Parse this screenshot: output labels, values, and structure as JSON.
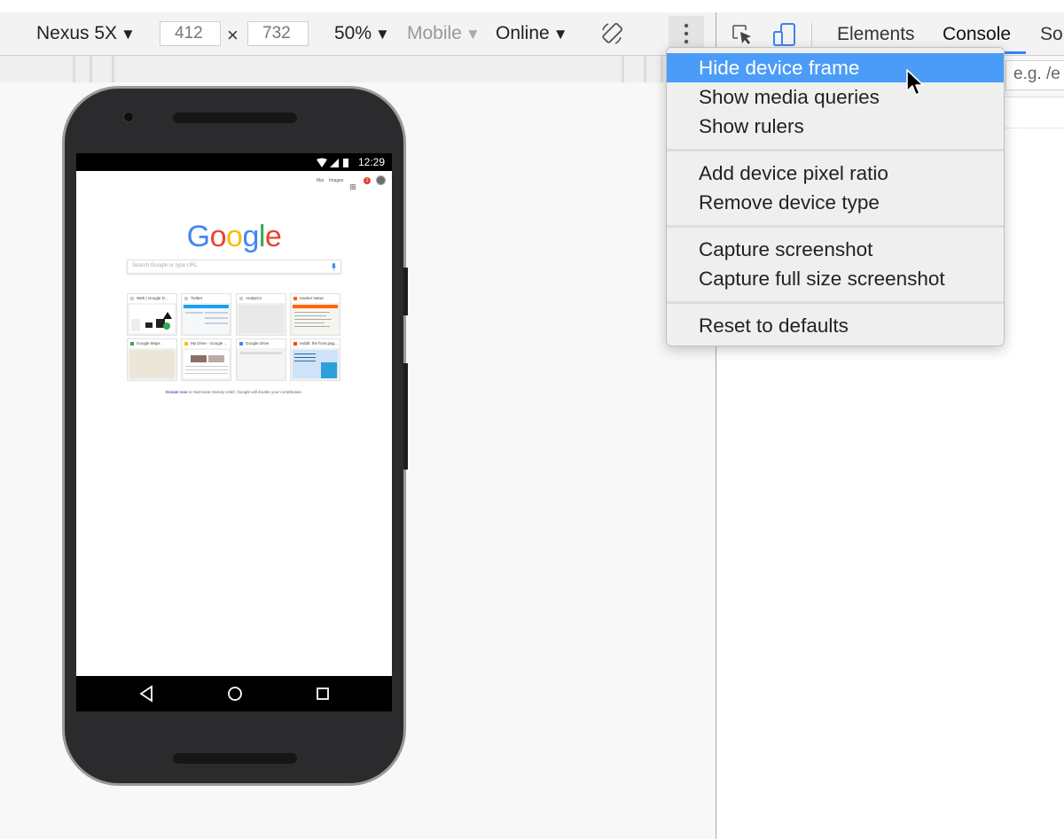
{
  "toolbar": {
    "device": "Nexus 5X",
    "width": "412",
    "height": "732",
    "dim_separator": "×",
    "zoom": "50%",
    "mode": "Mobile",
    "network": "Online",
    "caret": "▼"
  },
  "devtools": {
    "tabs": [
      "Elements",
      "Console",
      "So"
    ],
    "active_tab": "Console",
    "filter_placeholder": "e.g. /e"
  },
  "phone": {
    "status_time": "12:29",
    "top_links": [
      "Mai",
      "Images"
    ],
    "notification_count": "1",
    "logo": "Google",
    "search_placeholder": "Search Google or type URL",
    "tiles": [
      {
        "title": "Web | Google D..."
      },
      {
        "title": "Twitter"
      },
      {
        "title": "Analytics"
      },
      {
        "title": "Hacker News"
      },
      {
        "title": "Google Maps"
      },
      {
        "title": "My Drive - Google ..."
      },
      {
        "title": "Google Drive"
      },
      {
        "title": "reddit: the front pag..."
      }
    ],
    "footer_link": "Donate now",
    "footer_text": " to Hurricane Harvey relief. Google will double your contribution."
  },
  "menu": {
    "items": [
      {
        "label": "Hide device frame",
        "active": true
      },
      {
        "label": "Show media queries"
      },
      {
        "label": "Show rulers"
      },
      {
        "label": "Add device pixel ratio"
      },
      {
        "label": "Remove device type"
      },
      {
        "label": "Capture screenshot"
      },
      {
        "label": "Capture full size screenshot"
      },
      {
        "label": "Reset to defaults"
      }
    ]
  },
  "colors": {
    "menu_highlight": "#4b9cf8",
    "phone_body": "#2b2a2c",
    "accent_blue": "#3b82f6",
    "google_blue": "#4285f4",
    "google_red": "#ea4335",
    "google_yellow": "#fbbc05",
    "google_green": "#34a853"
  }
}
